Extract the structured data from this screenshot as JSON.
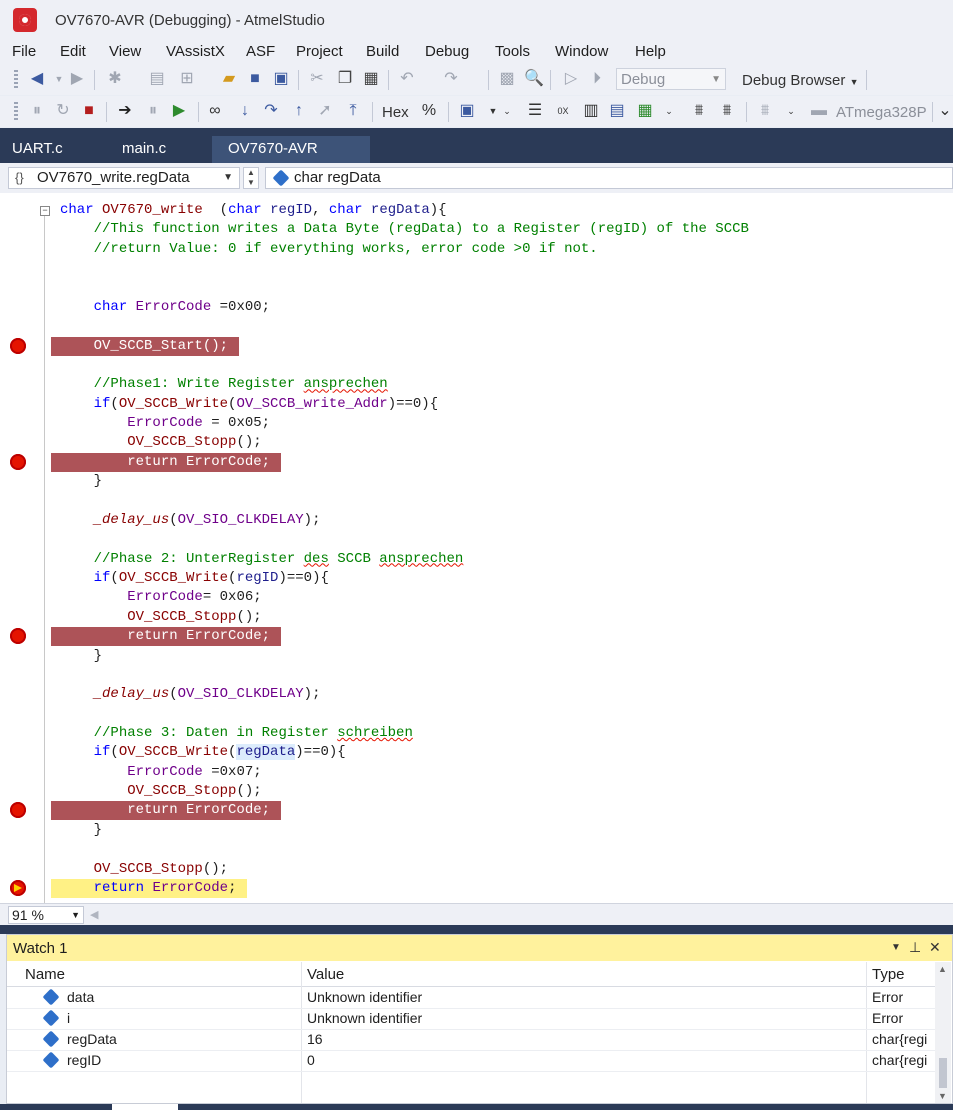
{
  "window": {
    "title": "OV7670-AVR (Debugging) - AtmelStudio"
  },
  "menu": [
    "File",
    "Edit",
    "View",
    "VAssistX",
    "ASF",
    "Project",
    "Build",
    "Debug",
    "Tools",
    "Window",
    "Help"
  ],
  "toolbar": {
    "config_combo": "Debug",
    "debug_browser": "Debug Browser",
    "hex_label": "Hex",
    "device_label": "ATmega328P"
  },
  "tabs": [
    "UART.c",
    "main.c",
    "OV7670-AVR"
  ],
  "nav": {
    "scope": "OV7670_write.regData",
    "member": "char regData"
  },
  "code": [
    {
      "text": "char OV7670_write  (char regID, char regData){"
    },
    {
      "text": "    //This function writes a Data Byte (regData) to a Register (regID) of the SCCB"
    },
    {
      "text": "    //return Value: 0 if everything works, error code >0 if not."
    },
    {
      "text": ""
    },
    {
      "text": ""
    },
    {
      "text": "    char ErrorCode =0x00;"
    },
    {
      "text": ""
    },
    {
      "text": "    OV_SCCB_Start();",
      "bp": true
    },
    {
      "text": ""
    },
    {
      "text": "    //Phase1: Write Register ansprechen"
    },
    {
      "text": "    if(OV_SCCB_Write(OV_SCCB_write_Addr)==0){"
    },
    {
      "text": "        ErrorCode = 0x05;"
    },
    {
      "text": "        OV_SCCB_Stopp();"
    },
    {
      "text": "        return ErrorCode;",
      "bp": true
    },
    {
      "text": "    }"
    },
    {
      "text": ""
    },
    {
      "text": "    _delay_us(OV_SIO_CLKDELAY);"
    },
    {
      "text": ""
    },
    {
      "text": "    //Phase 2: UnterRegister des SCCB ansprechen"
    },
    {
      "text": "    if(OV_SCCB_Write(regID)==0){"
    },
    {
      "text": "        ErrorCode= 0x06;"
    },
    {
      "text": "        OV_SCCB_Stopp();"
    },
    {
      "text": "        return ErrorCode;",
      "bp": true
    },
    {
      "text": "    }"
    },
    {
      "text": ""
    },
    {
      "text": "    _delay_us(OV_SIO_CLKDELAY);"
    },
    {
      "text": ""
    },
    {
      "text": "    //Phase 3: Daten in Register schreiben"
    },
    {
      "text": "    if(OV_SCCB_Write(regData)==0){"
    },
    {
      "text": "        ErrorCode =0x07;"
    },
    {
      "text": "        OV_SCCB_Stopp();"
    },
    {
      "text": "        return ErrorCode;",
      "bp": true
    },
    {
      "text": "    }"
    },
    {
      "text": ""
    },
    {
      "text": "    OV_SCCB_Stopp();"
    },
    {
      "text": "    return ErrorCode;",
      "current": true
    }
  ],
  "zoom": "91 %",
  "watch": {
    "title": "Watch 1",
    "columns": [
      "Name",
      "Value",
      "Type"
    ],
    "rows": [
      {
        "name": "data",
        "value": "Unknown identifier",
        "type": "Error"
      },
      {
        "name": "i",
        "value": "Unknown identifier",
        "type": "Error"
      },
      {
        "name": "regData",
        "value": "16",
        "type": "char{regi"
      },
      {
        "name": "regID",
        "value": "0",
        "type": "char{regi"
      }
    ]
  },
  "colors": {
    "breakpoint_line": "#ad5358",
    "current_line": "#fff185",
    "tab_strip": "#2b3a57",
    "watch_title": "#fff29d"
  }
}
